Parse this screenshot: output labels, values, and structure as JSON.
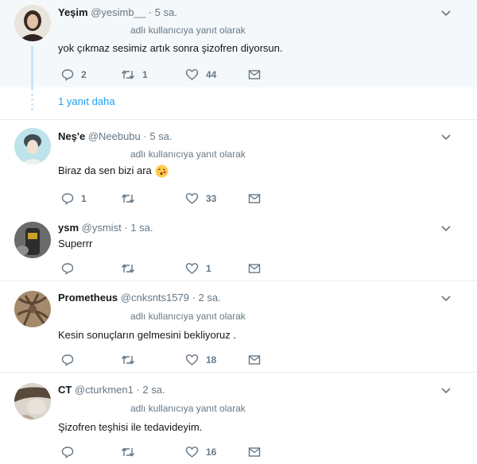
{
  "tweets": [
    {
      "name": "Yeşim",
      "handle": "@yesimb__",
      "time": "· 5 sa.",
      "reply_to": "adlı kullanıcıya yanıt olarak",
      "text": "yok çıkmaz sesimiz artık sonra şizofren diyorsun.",
      "replies": "2",
      "retweets": "1",
      "likes": "44"
    },
    {
      "name": "Neş'e",
      "handle": "@Neebubu",
      "time": "· 5 sa.",
      "reply_to": "adlı kullanıcıya yanıt olarak",
      "text": "Biraz da sen bizi ara",
      "emoji": "kissing-face-emoji",
      "replies": "1",
      "retweets": "",
      "likes": "33"
    },
    {
      "name": "ysm",
      "handle": "@ysmist",
      "time": "· 1 sa.",
      "reply_to": "",
      "text": "Superrr",
      "replies": "",
      "retweets": "",
      "likes": "1"
    },
    {
      "name": "Prometheus",
      "handle": "@cnksnts1579",
      "time": "· 2 sa.",
      "reply_to": "adlı kullanıcıya yanıt olarak",
      "text": "Kesin sonuçların gelmesini bekliyoruz .",
      "replies": "",
      "retweets": "",
      "likes": "18"
    },
    {
      "name": "CT",
      "handle": "@cturkmen1",
      "time": "· 2 sa.",
      "reply_to": "adlı kullanıcıya yanıt olarak",
      "text": "Şizofren teşhisi ile tedavideyim.",
      "replies": "",
      "retweets": "",
      "likes": "16"
    }
  ],
  "show_more": "1 yanıt daha",
  "icons": {
    "reply": "reply-icon",
    "retweet": "retweet-icon",
    "like": "heart-icon",
    "dm": "envelope-icon",
    "menu": "chevron-down-icon"
  },
  "colors": {
    "accent": "#1da1f2",
    "muted": "#657786",
    "thread": "#cce4f6",
    "highlight": "#f5f8fa"
  }
}
